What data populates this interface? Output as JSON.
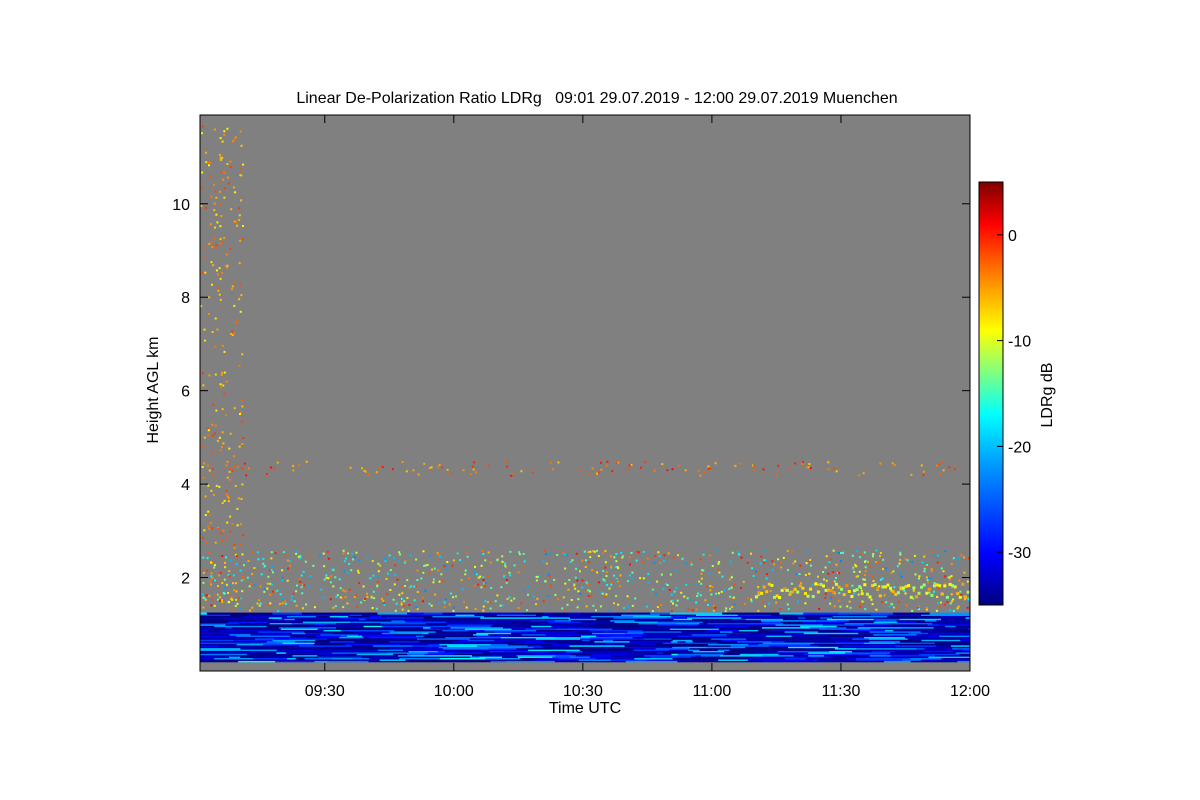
{
  "chart_data": {
    "type": "heatmap",
    "title": "Linear De-Polarization Ratio LDRg   09:01 29.07.2019 - 12:00 29.07.2019 Muenchen",
    "xlabel": "Time UTC",
    "ylabel": "Height AGL km",
    "colorbar_label": "LDRg dB",
    "x_range": [
      "09:01",
      "12:00"
    ],
    "xlim_minutes": [
      541,
      720
    ],
    "x_ticks": [
      {
        "label": "09:30",
        "minute": 570
      },
      {
        "label": "10:00",
        "minute": 600
      },
      {
        "label": "10:30",
        "minute": 630
      },
      {
        "label": "11:00",
        "minute": 660
      },
      {
        "label": "11:30",
        "minute": 690
      },
      {
        "label": "12:00",
        "minute": 720
      }
    ],
    "ylim": [
      0,
      11.9
    ],
    "y_ticks": [
      2,
      4,
      6,
      8,
      10
    ],
    "colorbar_range": [
      -35,
      5
    ],
    "colorbar_ticks": [
      0,
      -10,
      -20,
      -30
    ],
    "colormap": [
      "#000080",
      "#0000ff",
      "#0080ff",
      "#00ffff",
      "#80ff80",
      "#ffff00",
      "#ff8000",
      "#ff0000",
      "#800000"
    ],
    "no_data_color": "#808080",
    "layers": [
      {
        "feature": "boundary layer",
        "height_km": [
          0.2,
          1.25
        ],
        "ldr_db_range": [
          -35,
          -20
        ]
      },
      {
        "feature": "sparse aerosol / noise layer",
        "height_km": [
          1.3,
          2.6
        ],
        "ldr_db_range": [
          -25,
          0
        ]
      },
      {
        "feature": "elevated layer (late)",
        "time": [
          "11:10",
          "12:00"
        ],
        "height_km": [
          1.6,
          1.9
        ],
        "ldr_db_range": [
          -15,
          -5
        ]
      },
      {
        "feature": "scattered points",
        "height_km": [
          4.2,
          4.5
        ],
        "ldr_db_range": [
          -10,
          0
        ]
      }
    ],
    "grid": false
  }
}
